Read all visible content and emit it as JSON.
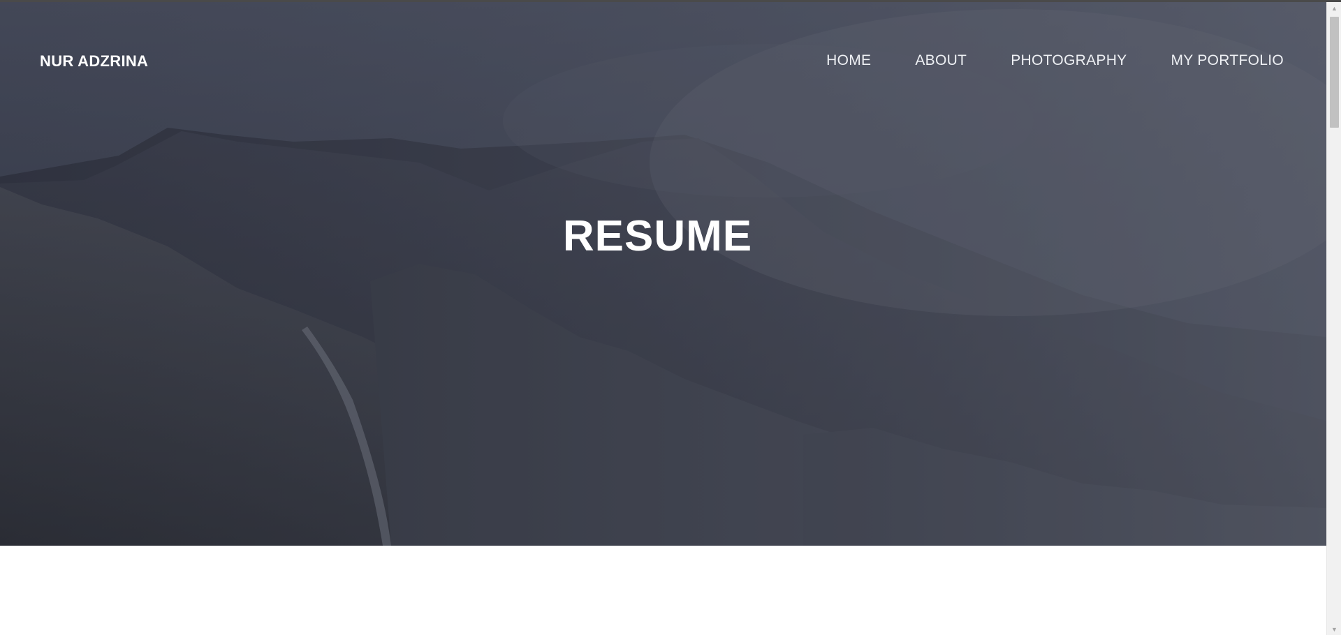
{
  "header": {
    "brand": "NUR ADZRINA",
    "nav": [
      {
        "label": "HOME"
      },
      {
        "label": "ABOUT"
      },
      {
        "label": "PHOTOGRAPHY"
      },
      {
        "label": "MY PORTFOLIO"
      }
    ]
  },
  "hero": {
    "title": "RESUME"
  },
  "scrollbar": {
    "up_icon": "chevron-up-icon",
    "down_icon": "chevron-down-icon"
  }
}
